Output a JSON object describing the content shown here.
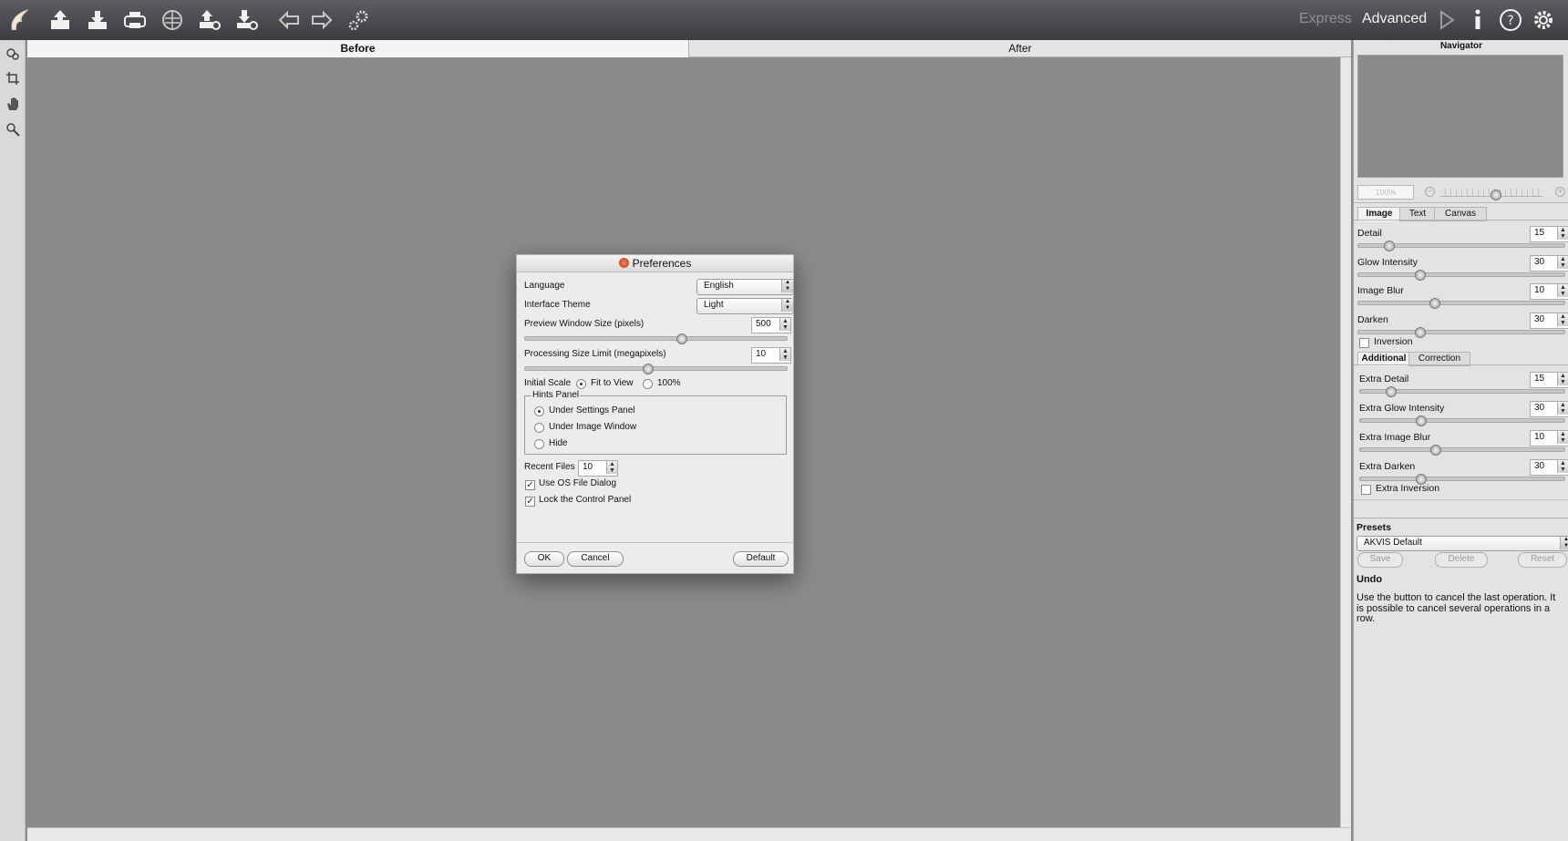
{
  "toolbar": {
    "icons": [
      "app-logo",
      "open-image",
      "save-image",
      "print",
      "share",
      "batch-export",
      "batch-import",
      "back-arrow",
      "forward-arrow",
      "plugin-settings"
    ],
    "modes": {
      "express": "Express",
      "advanced": "Advanced"
    },
    "right_icons": [
      "run",
      "info",
      "help",
      "preferences"
    ]
  },
  "left_tools": [
    "brush-tool",
    "crop-tool",
    "hand-tool",
    "zoom-tool"
  ],
  "view_tabs": {
    "before": "Before",
    "after": "After"
  },
  "navigator": {
    "title": "Navigator",
    "zoom": "100%"
  },
  "panel_tabs": [
    "Image",
    "Text",
    "Canvas"
  ],
  "image_settings": [
    {
      "label": "Detail",
      "value": "15",
      "level": 0.15
    },
    {
      "label": "Glow Intensity",
      "value": "30",
      "level": 0.3
    },
    {
      "label": "Image Blur",
      "value": "10",
      "level": 0.37
    },
    {
      "label": "Darken",
      "value": "30",
      "level": 0.3
    }
  ],
  "inversion_label": "Inversion",
  "sub_tabs": [
    "Additional",
    "Correction"
  ],
  "additional_settings": [
    {
      "label": "Extra Detail",
      "value": "15",
      "level": 0.15
    },
    {
      "label": "Extra Glow Intensity",
      "value": "30",
      "level": 0.3
    },
    {
      "label": "Extra Image Blur",
      "value": "10",
      "level": 0.37
    },
    {
      "label": "Extra Darken",
      "value": "30",
      "level": 0.3
    }
  ],
  "extra_inversion_label": "Extra Inversion",
  "presets": {
    "title": "Presets",
    "selected": "AKVIS Default",
    "save": "Save",
    "delete": "Delete",
    "reset": "Reset"
  },
  "hint": {
    "title": "Undo",
    "text": "Use the button to cancel the last operation. It is possible to cancel several operations in a row."
  },
  "preferences": {
    "title": "Preferences",
    "language_label": "Language",
    "language_value": "English",
    "theme_label": "Interface Theme",
    "theme_value": "Light",
    "preview_label": "Preview Window Size (pixels)",
    "preview_value": "500",
    "preview_level": 0.6,
    "processing_label": "Processing Size Limit (megapixels)",
    "processing_value": "10",
    "processing_level": 0.47,
    "initial_scale_label": "Initial Scale",
    "fit_to_view": "Fit to View",
    "scale_100": "100%",
    "hints_panel_label": "Hints Panel",
    "hints_options": [
      "Under Settings Panel",
      "Under Image Window",
      "Hide"
    ],
    "recent_files_label": "Recent Files",
    "recent_files_value": "10",
    "use_os_dialog": "Use OS File Dialog",
    "lock_panel": "Lock the Control Panel",
    "ok": "OK",
    "cancel": "Cancel",
    "default": "Default"
  }
}
